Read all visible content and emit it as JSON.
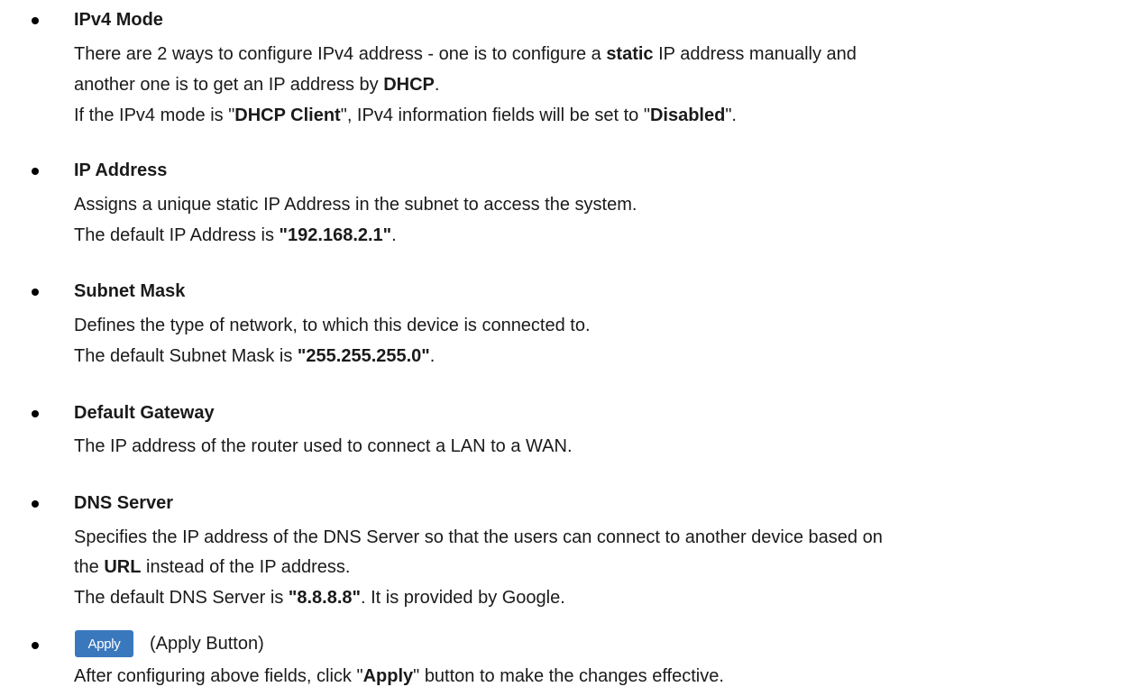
{
  "items": [
    {
      "title": "IPv4 Mode",
      "lines": [
        [
          "There are 2 ways to configure IPv4 address - one is to configure a ",
          "static",
          " IP address manually and"
        ],
        [
          "another one is to get an IP address by ",
          "DHCP",
          "."
        ],
        [
          "If the IPv4 mode is \"",
          "DHCP Client",
          "\", IPv4 information fields will be set to \"",
          "Disabled",
          "\"."
        ]
      ]
    },
    {
      "title": "IP Address",
      "lines": [
        [
          "Assigns a unique static IP Address in the subnet to access the system."
        ],
        [
          "The default IP Address is ",
          "\"192.168.2.1\"",
          "."
        ]
      ]
    },
    {
      "title": "Subnet Mask",
      "lines": [
        [
          "Defines the type of network, to which this device is connected to."
        ],
        [
          "The default Subnet Mask is ",
          "\"255.255.255.0\"",
          "."
        ]
      ]
    },
    {
      "title": "Default Gateway",
      "lines": [
        [
          "The IP address of the router used to connect a LAN to a WAN."
        ]
      ]
    },
    {
      "title": "DNS Server",
      "lines": [
        [
          "Specifies the IP address of the DNS Server so that the users can connect to another device based on"
        ],
        [
          "the ",
          "URL",
          " instead of the IP address."
        ],
        [
          "The default DNS Server is ",
          "\"8.8.8.8\"",
          ". It is provided by Google."
        ]
      ]
    }
  ],
  "apply": {
    "button_label": "Apply",
    "caption": "(Apply Button)",
    "lines": [
      [
        "After configuring above fields, click \"",
        "Apply",
        "\" button to make the changes effective."
      ]
    ]
  }
}
